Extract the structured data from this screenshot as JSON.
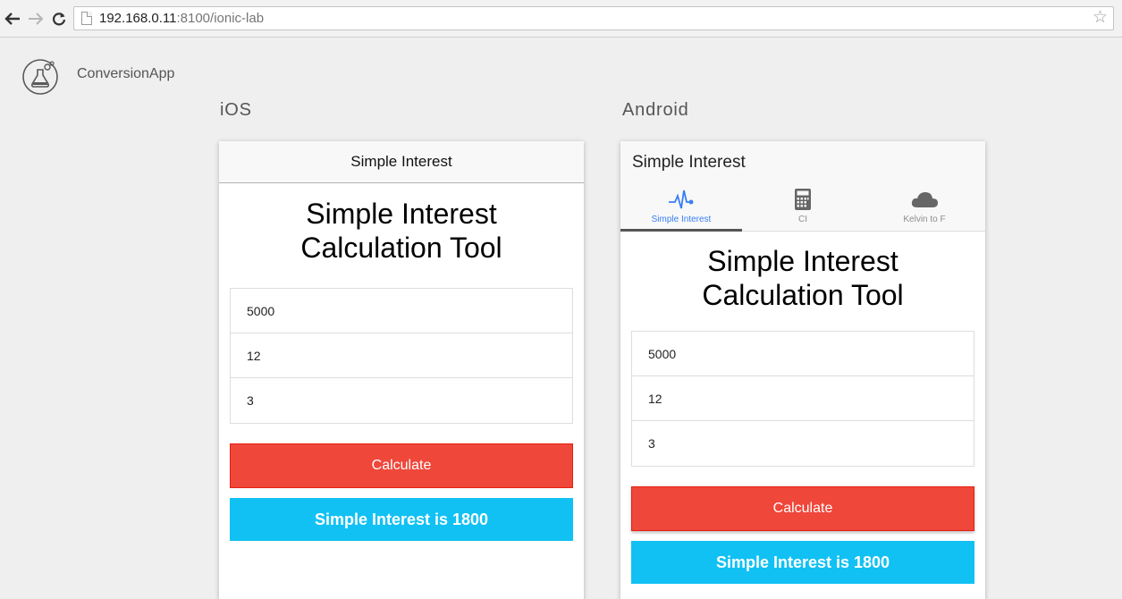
{
  "browser": {
    "url_host": "192.168.0.11",
    "url_rest": ":8100/ionic-lab",
    "icons": [
      "back-arrow-icon",
      "forward-arrow-icon",
      "reload-icon",
      "page-icon",
      "bookmark-star-icon"
    ]
  },
  "lab": {
    "app_name": "ConversionApp",
    "ios_label": "iOS",
    "android_label": "Android"
  },
  "ios": {
    "header_title": "Simple Interest",
    "heading": "Simple Interest Calculation Tool",
    "inputs": [
      "5000",
      "12",
      "3"
    ],
    "calculate_label": "Calculate",
    "result": "Simple Interest is 1800"
  },
  "android": {
    "header_title": "Simple Interest",
    "tabs": [
      {
        "label": "Simple Interest",
        "icon": "pulse-icon",
        "active": true
      },
      {
        "label": "CI",
        "icon": "calculator-icon",
        "active": false
      },
      {
        "label": "Kelvin to F",
        "icon": "cloud-icon",
        "active": false
      }
    ],
    "heading": "Simple Interest Calculation Tool",
    "inputs": [
      "5000",
      "12",
      "3"
    ],
    "calculate_label": "Calculate",
    "result": "Simple Interest is 1800"
  },
  "colors": {
    "calculate": "#ef473a",
    "result": "#11c1f3",
    "active_tab": "#387ef5"
  }
}
